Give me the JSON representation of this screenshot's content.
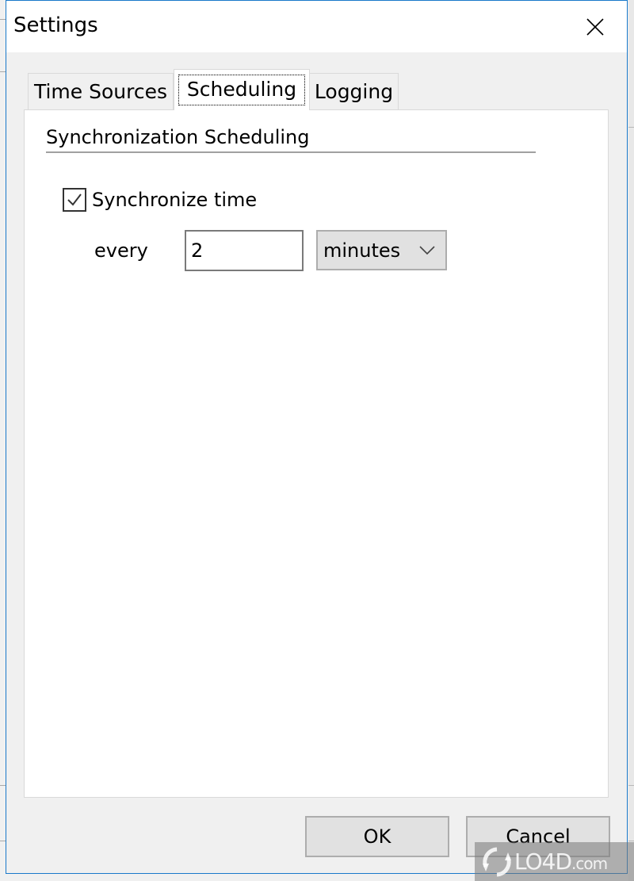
{
  "dialog": {
    "title": "Settings",
    "close_icon": "close-icon"
  },
  "tabs": [
    {
      "label": "Time Sources",
      "active": false
    },
    {
      "label": "Scheduling",
      "active": true
    },
    {
      "label": "Logging",
      "active": false
    }
  ],
  "scheduling": {
    "group_title": "Synchronization Scheduling",
    "sync_checkbox": {
      "label": "Synchronize time",
      "checked": true
    },
    "every_label": "every",
    "interval_value": "2",
    "unit_selected": "minutes"
  },
  "buttons": {
    "ok": "OK",
    "cancel": "Cancel"
  },
  "watermark": {
    "brand": "LO4D",
    "suffix": ".com"
  },
  "colors": {
    "window_border": "#1979ca",
    "dialog_bg": "#f0f0f0",
    "panel_bg": "#ffffff",
    "button_bg": "#e1e1e1"
  }
}
